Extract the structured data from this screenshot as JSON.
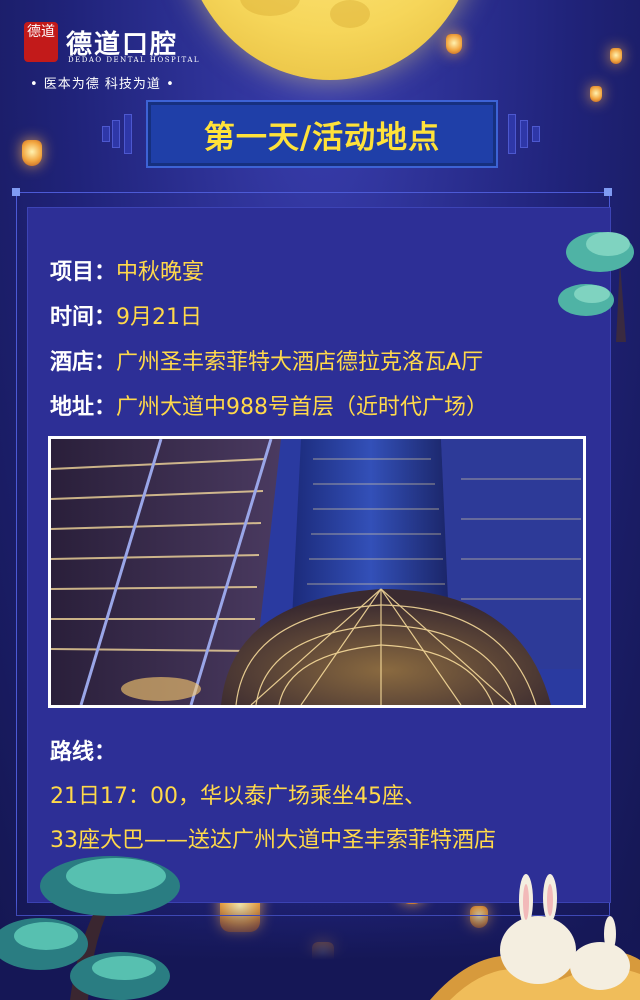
{
  "logo": {
    "mark": "德道",
    "title": "德道口腔",
    "subtitle": "DEDAO DENTAL HOSPITAL",
    "slogan": "• 医本为德  科技为道 •"
  },
  "header": {
    "title": "第一天/活动地点"
  },
  "event": [
    {
      "label": "项目：",
      "value": "中秋晚宴"
    },
    {
      "label": "时间：",
      "value": "9月21日"
    },
    {
      "label": "酒店：",
      "value": "广州圣丰索菲特大酒店德拉克洛瓦A厅"
    },
    {
      "label": "地址：",
      "value": "广州大道中988号首层（近时代广场）"
    }
  ],
  "route": {
    "label": "路线：",
    "lines": [
      "21日17：00，华以泰广场乘坐45座、",
      "33座大巴——送达广州大道中圣丰索菲特酒店"
    ]
  },
  "colors": {
    "background": "#20237a",
    "panel": "#2d2f96",
    "title_box": "#1f3fa8",
    "accent_yellow": "#ffd94a",
    "title_yellow": "#ffe23a"
  }
}
